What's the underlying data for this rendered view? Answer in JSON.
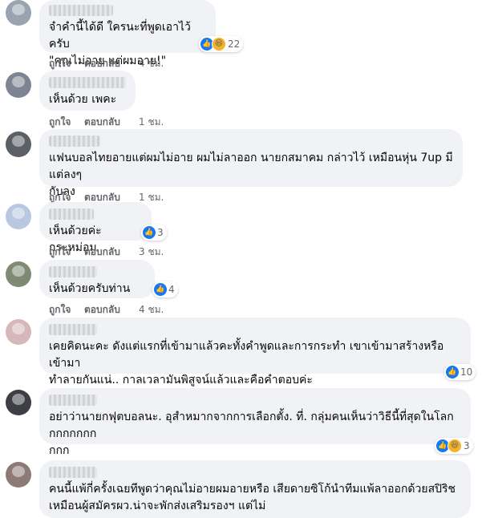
{
  "actions": {
    "like": "ถูกใจ",
    "reply": "ตอบกลับ"
  },
  "comments": [
    {
      "text": "จำคำนี้ได้ดี ใครนะที่พูดเอาไว้ครับ\n\"คุณไม่อาย แต่ผมอาย!\"",
      "reactions": [
        "like",
        "haha"
      ],
      "count": "22",
      "time": "4 ชม."
    },
    {
      "text": "เห็นด้วย เพคะ",
      "reactions": [],
      "count": "",
      "time": "1 ชม."
    },
    {
      "text": "แฟนบอลไทยอายแต่ผมไม่อาย ผมไม่ลาออก นายกสมาคม กล่าวไว้ เหมือนหุ่น 7up มีแต่ลงๆ\nกับลง",
      "reactions": [],
      "count": "",
      "time": "1 ชม."
    },
    {
      "text": "เห็นด้วยค่ะกระหม่อม",
      "reactions": [
        "like"
      ],
      "count": "3",
      "time": "3 ชม."
    },
    {
      "text": "เห็นด้วยครับท่าน",
      "reactions": [
        "like"
      ],
      "count": "4",
      "time": "4 ชม."
    },
    {
      "text": "เคยคิดนะคะ ดังแต่แรกที่เข้ามาแล้วคะทั้งคำพูดและการกระทำ เขาเข้ามาสร้างหรือเข้ามา\nทำลายกันแน่.. กาลเวลามันพิสูจน์แล้วและคือคำตอบค่ะ",
      "reactions": [
        "like"
      ],
      "count": "10",
      "time": ""
    },
    {
      "text": "อย่าว่านายกฟุตบอลนะ. อุสำหมากจากการเลือกตั้ง. ที่. กลุ่มคนเห็นว่าวิธีนี้ที่สุดในโลกกกกกกกก\nกกก",
      "reactions": [
        "like",
        "haha"
      ],
      "count": "3",
      "time": ""
    },
    {
      "text": "คนนี้แพ้กี่ครั้งเฉยทีพูดว่าคุณไม่อายผมอายหรือ เสียดายซิโก้นำทีมแพ้ลาออกด้วยสปิริช\nเหมือนผู้สมัครผว.น่าจะพักส่งเสริมรองฯ แต่ไม่",
      "reactions": [],
      "count": "",
      "time": ""
    }
  ]
}
